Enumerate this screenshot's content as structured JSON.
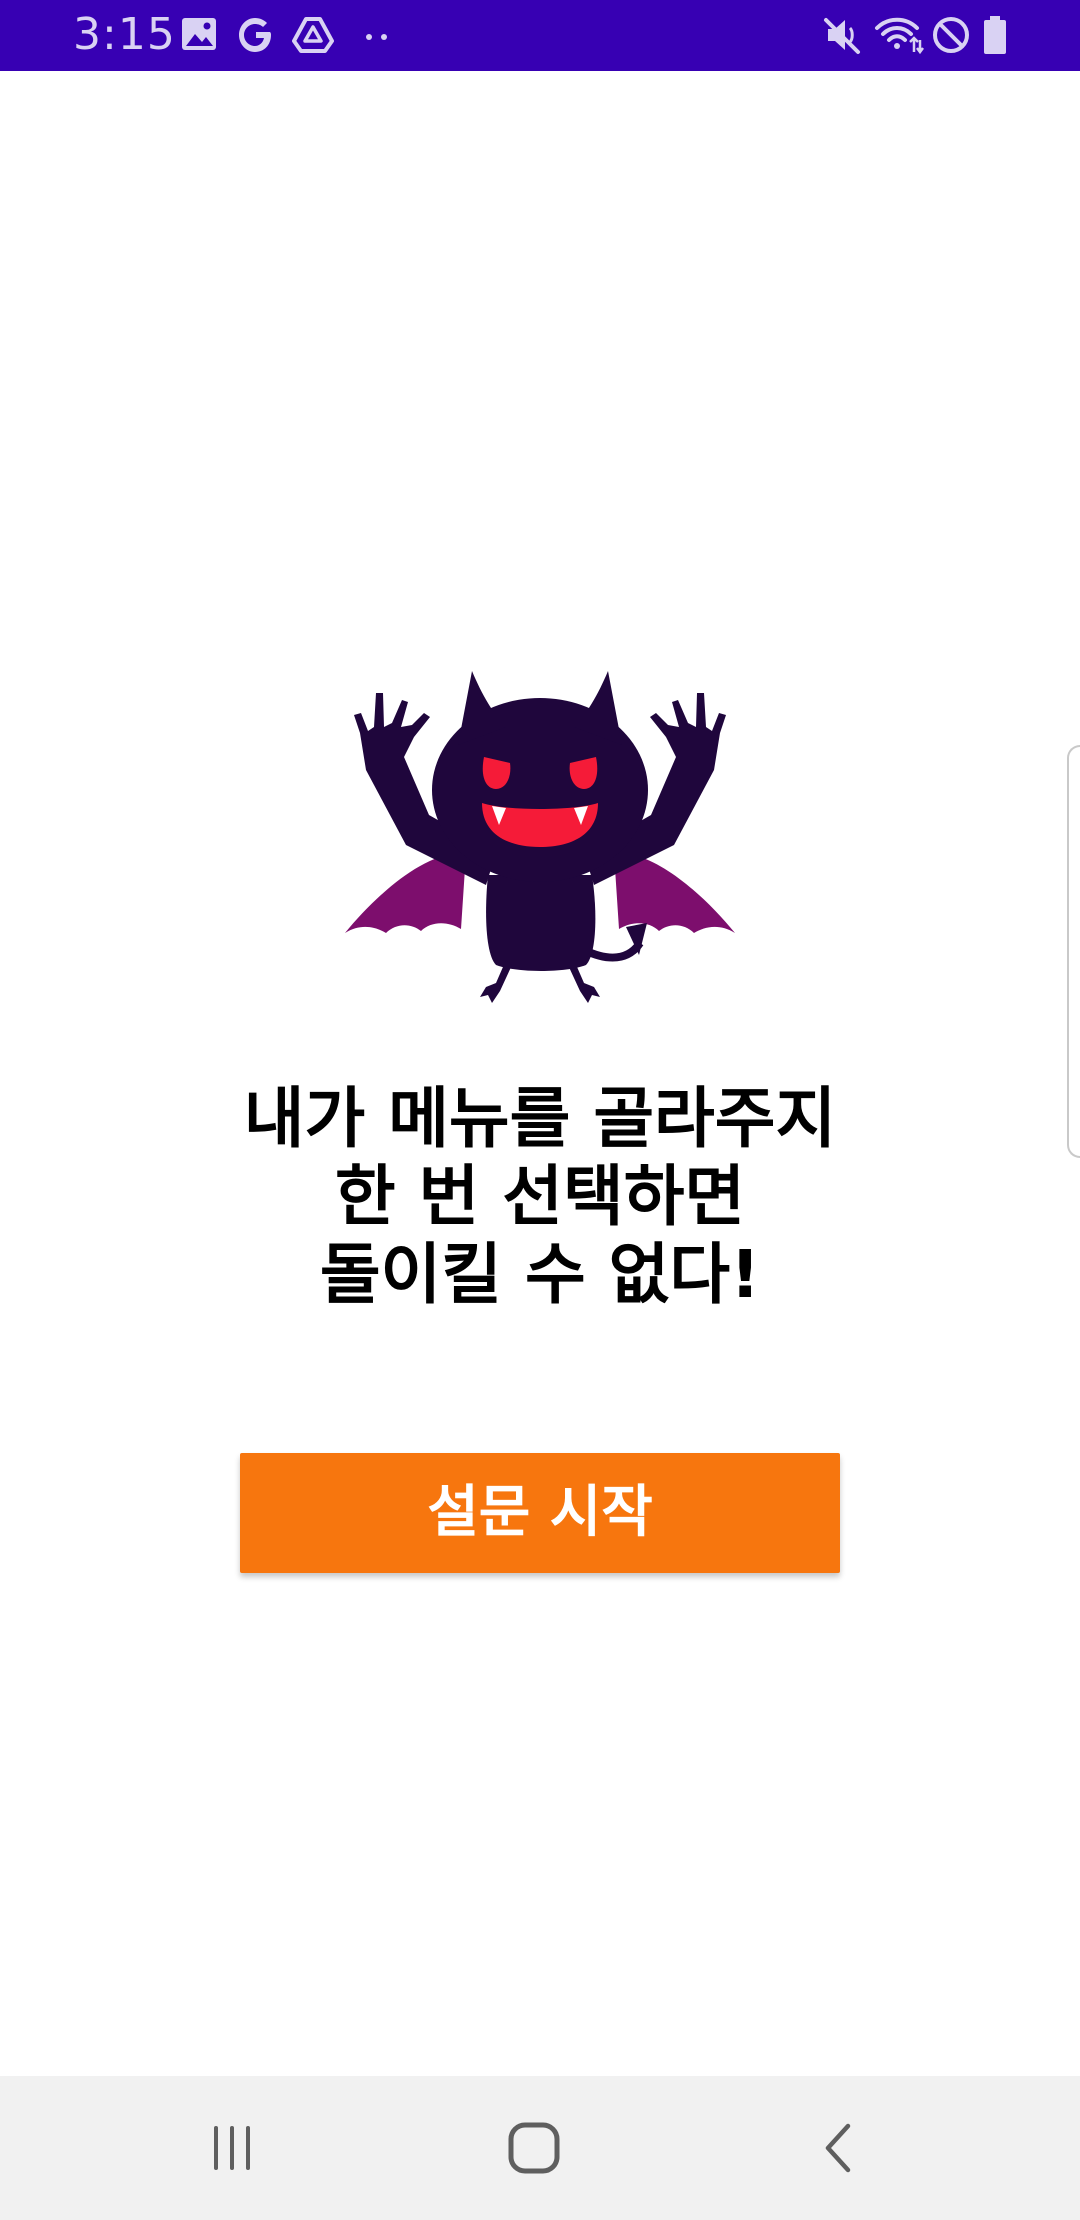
{
  "status_bar": {
    "time": "3:15",
    "left_icons": [
      "image-icon",
      "google-icon",
      "drive-icon",
      "more-dots-icon"
    ],
    "right_icons": [
      "mute-icon",
      "wifi-icon",
      "do-not-disturb-icon",
      "battery-icon"
    ],
    "background_color": "#3700b3"
  },
  "main": {
    "mascot": "devil-mascot",
    "headline_lines": [
      "내가 메뉴를 골라주지",
      "한 번 선택하면",
      "돌이킬 수 없다!"
    ],
    "start_button_label": "설문 시작",
    "accent_color": "#f7760e"
  },
  "nav_bar": {
    "buttons": [
      "recent-apps-icon",
      "home-icon",
      "back-icon"
    ]
  }
}
